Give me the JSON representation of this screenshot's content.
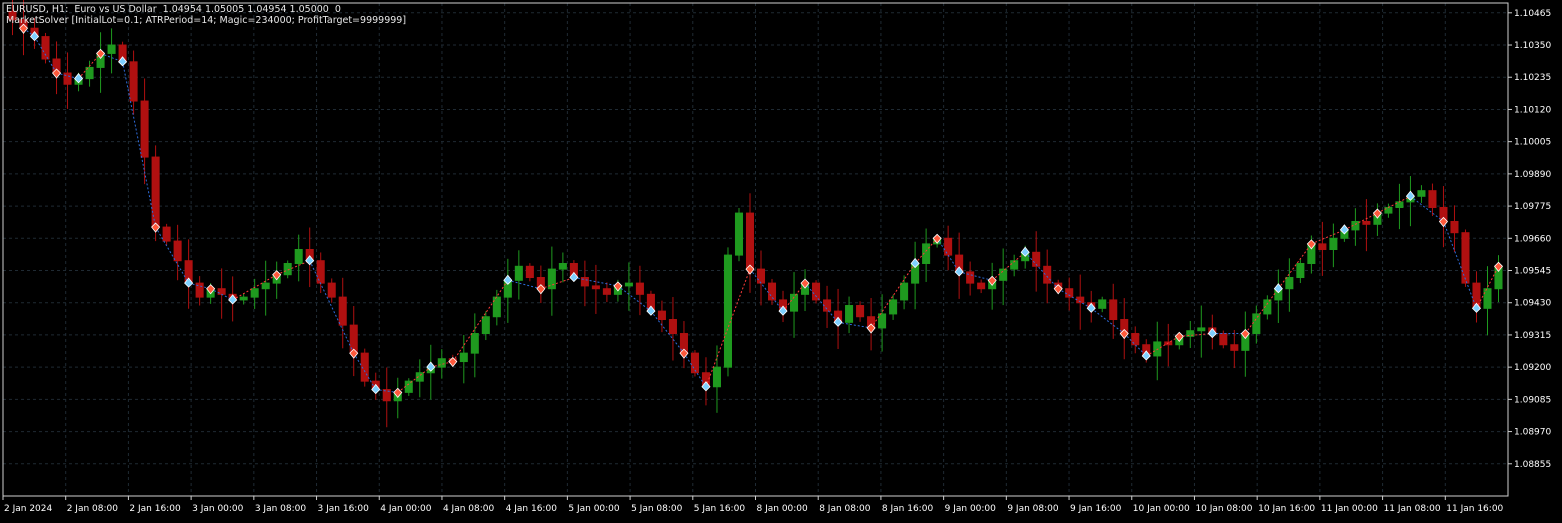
{
  "header": {
    "symbol_line": "EURUSD, H1:  Euro vs US Dollar  1.04954 1.05005 1.04954 1.05000  0",
    "indicator_line": "MarketSolver [InitialLot=0.1; ATRPeriod=14; Magic=234000; ProfitTarget=9999999]"
  },
  "colors": {
    "background": "#000000",
    "grid": "#1f2a33",
    "axis_text": "#ffffff",
    "bull": "#1f9a1f",
    "bear": "#b01010",
    "marker_buy": "#7fd0ff",
    "marker_sell": "#ff5a3c",
    "line_up": "#ff3b3b",
    "line_down": "#2e6bd9"
  },
  "chart_data": {
    "type": "candlestick",
    "symbol": "EURUSD",
    "timeframe": "H1",
    "ylim": [
      1.0874,
      1.105
    ],
    "y_ticks": [
      "1.10465",
      "1.10350",
      "1.10235",
      "1.10120",
      "1.10005",
      "1.09890",
      "1.09775",
      "1.09660",
      "1.09545",
      "1.09430",
      "1.09315",
      "1.09200",
      "1.09085",
      "1.08970",
      "1.08855"
    ],
    "x_ticks": [
      "2 Jan 2024",
      "2 Jan 08:00",
      "2 Jan 16:00",
      "3 Jan 00:00",
      "3 Jan 08:00",
      "3 Jan 16:00",
      "4 Jan 00:00",
      "4 Jan 08:00",
      "4 Jan 16:00",
      "5 Jan 00:00",
      "5 Jan 08:00",
      "5 Jan 16:00",
      "8 Jan 00:00",
      "8 Jan 08:00",
      "8 Jan 16:00",
      "9 Jan 00:00",
      "9 Jan 08:00",
      "9 Jan 16:00",
      "10 Jan 00:00",
      "10 Jan 08:00",
      "10 Jan 16:00",
      "11 Jan 00:00",
      "11 Jan 08:00",
      "11 Jan 16:00"
    ],
    "closes": [
      1.1044,
      1.1041,
      1.1038,
      1.103,
      1.1025,
      1.1021,
      1.1023,
      1.1027,
      1.1032,
      1.1035,
      1.1029,
      1.1015,
      1.0995,
      1.097,
      1.0965,
      1.0958,
      1.095,
      1.0945,
      1.0948,
      1.0946,
      1.0944,
      1.0945,
      1.0948,
      1.095,
      1.0953,
      1.0957,
      1.0962,
      1.0958,
      1.095,
      1.0945,
      1.0935,
      1.0925,
      1.0915,
      1.0912,
      1.0908,
      1.0911,
      1.0915,
      1.0918,
      1.092,
      1.0923,
      1.0922,
      1.0925,
      1.0932,
      1.0938,
      1.0945,
      1.0951,
      1.0956,
      1.0952,
      1.0948,
      1.0955,
      1.0957,
      1.0952,
      1.0949,
      1.0948,
      1.0946,
      1.0949,
      1.095,
      1.0946,
      1.094,
      1.0937,
      1.0932,
      1.0925,
      1.0918,
      1.0913,
      1.092,
      1.096,
      1.0975,
      1.0955,
      1.095,
      1.0944,
      1.094,
      1.0946,
      1.095,
      1.0944,
      1.094,
      1.0936,
      1.0942,
      1.0938,
      1.0934,
      1.0939,
      1.0944,
      1.095,
      1.0957,
      1.0964,
      1.0966,
      1.096,
      1.0954,
      1.095,
      1.0948,
      1.0951,
      1.0955,
      1.0958,
      1.0961,
      1.0956,
      1.095,
      1.0948,
      1.0945,
      1.0943,
      1.0941,
      1.0944,
      1.0937,
      1.0932,
      1.0928,
      1.0924,
      1.0929,
      1.0928,
      1.0931,
      1.0933,
      1.0934,
      1.0932,
      1.0928,
      1.0926,
      1.0932,
      1.0939,
      1.0944,
      1.0948,
      1.0952,
      1.0957,
      1.0964,
      1.0962,
      1.0966,
      1.0969,
      1.0972,
      1.0971,
      1.0975,
      1.0977,
      1.0979,
      1.0981,
      1.0983,
      1.0977,
      1.0972,
      1.0968,
      1.095,
      1.0941,
      1.0948,
      1.0956
    ],
    "swing_markers": [
      {
        "i": 1,
        "kind": "sell"
      },
      {
        "i": 2,
        "kind": "buy"
      },
      {
        "i": 4,
        "kind": "sell"
      },
      {
        "i": 6,
        "kind": "buy"
      },
      {
        "i": 8,
        "kind": "sell"
      },
      {
        "i": 10,
        "kind": "buy"
      },
      {
        "i": 13,
        "kind": "sell"
      },
      {
        "i": 16,
        "kind": "buy"
      },
      {
        "i": 18,
        "kind": "sell"
      },
      {
        "i": 20,
        "kind": "buy"
      },
      {
        "i": 24,
        "kind": "sell"
      },
      {
        "i": 27,
        "kind": "buy"
      },
      {
        "i": 31,
        "kind": "sell"
      },
      {
        "i": 33,
        "kind": "buy"
      },
      {
        "i": 35,
        "kind": "sell"
      },
      {
        "i": 38,
        "kind": "buy"
      },
      {
        "i": 40,
        "kind": "sell"
      },
      {
        "i": 45,
        "kind": "buy"
      },
      {
        "i": 48,
        "kind": "sell"
      },
      {
        "i": 51,
        "kind": "buy"
      },
      {
        "i": 55,
        "kind": "sell"
      },
      {
        "i": 58,
        "kind": "buy"
      },
      {
        "i": 61,
        "kind": "sell"
      },
      {
        "i": 63,
        "kind": "buy"
      },
      {
        "i": 67,
        "kind": "sell"
      },
      {
        "i": 70,
        "kind": "buy"
      },
      {
        "i": 72,
        "kind": "sell"
      },
      {
        "i": 75,
        "kind": "buy"
      },
      {
        "i": 78,
        "kind": "sell"
      },
      {
        "i": 82,
        "kind": "buy"
      },
      {
        "i": 84,
        "kind": "sell"
      },
      {
        "i": 86,
        "kind": "buy"
      },
      {
        "i": 89,
        "kind": "sell"
      },
      {
        "i": 92,
        "kind": "buy"
      },
      {
        "i": 95,
        "kind": "sell"
      },
      {
        "i": 98,
        "kind": "buy"
      },
      {
        "i": 101,
        "kind": "sell"
      },
      {
        "i": 103,
        "kind": "buy"
      },
      {
        "i": 106,
        "kind": "sell"
      },
      {
        "i": 109,
        "kind": "buy"
      },
      {
        "i": 112,
        "kind": "sell"
      },
      {
        "i": 115,
        "kind": "buy"
      },
      {
        "i": 118,
        "kind": "sell"
      },
      {
        "i": 121,
        "kind": "buy"
      },
      {
        "i": 124,
        "kind": "sell"
      },
      {
        "i": 127,
        "kind": "buy"
      },
      {
        "i": 130,
        "kind": "sell"
      },
      {
        "i": 133,
        "kind": "buy"
      },
      {
        "i": 135,
        "kind": "sell"
      }
    ]
  }
}
